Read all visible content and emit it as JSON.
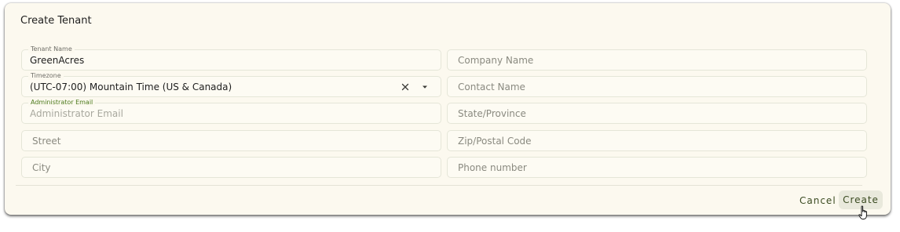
{
  "dialog": {
    "title": "Create Tenant"
  },
  "form": {
    "tenant_name": {
      "label": "Tenant Name",
      "value": "GreenAcres"
    },
    "timezone": {
      "label": "Timezone",
      "value": "(UTC-07:00) Mountain Time (US & Canada)"
    },
    "admin_email": {
      "label": "Administrator Email",
      "placeholder": "Administrator Email"
    },
    "street": {
      "placeholder": "Street"
    },
    "city": {
      "placeholder": "City"
    },
    "company_name": {
      "placeholder": "Company Name"
    },
    "contact_name": {
      "placeholder": "Contact Name"
    },
    "state": {
      "placeholder": "State/Province"
    },
    "zip": {
      "placeholder": "Zip/Postal Code"
    },
    "phone": {
      "placeholder": "Phone number"
    }
  },
  "actions": {
    "cancel_label": "Cancel",
    "create_label": "Create"
  },
  "colors": {
    "dialog_background": "#fcf9ef",
    "focused_label": "#4c7a1c",
    "button_text": "#3a4a20"
  },
  "icons": {
    "clear": "close-icon",
    "dropdown": "caret-down-icon",
    "cursor": "hand-pointer-icon"
  }
}
